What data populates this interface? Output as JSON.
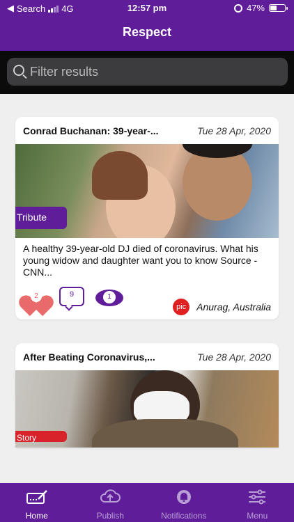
{
  "status": {
    "carrier": "Search",
    "network": "4G",
    "time": "12:57 pm",
    "battery": "47%"
  },
  "header": {
    "title": "Respect"
  },
  "search": {
    "placeholder": "Filter results"
  },
  "cards": [
    {
      "title": "Conrad Buchanan: 39-year-...",
      "date": "Tue 28 Apr, 2020",
      "tag": "Tribute",
      "description": "A healthy 39-year-old DJ died of coronavirus. What his young widow and daughter want you to know Source - CNN...",
      "likes": "2",
      "comments": "9",
      "views": "1",
      "avatar": "pic",
      "author": "Anurag, Australia"
    },
    {
      "title": "After Beating Coronavirus,...",
      "date": "Tue 28 Apr, 2020",
      "tag": "Story"
    }
  ],
  "tabs": [
    {
      "label": "Home",
      "icon": "home-icon",
      "active": true
    },
    {
      "label": "Publish",
      "icon": "cloud-upload-icon",
      "active": false
    },
    {
      "label": "Notifications",
      "icon": "bell-icon",
      "active": false
    },
    {
      "label": "Menu",
      "icon": "sliders-icon",
      "active": false
    }
  ],
  "colors": {
    "brand": "#5f1d9a",
    "heart": "#e96a6a",
    "avatar": "#e02020"
  }
}
